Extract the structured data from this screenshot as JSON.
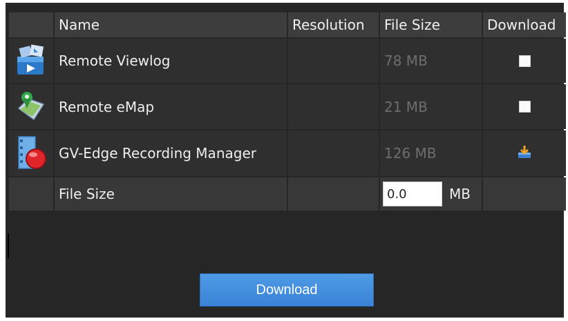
{
  "table": {
    "headers": {
      "name": "Name",
      "resolution": "Resolution",
      "file_size": "File Size",
      "download": "Download"
    },
    "rows": [
      {
        "name": "Remote Viewlog",
        "resolution": "",
        "file_size": "78 MB",
        "download_state": "unchecked",
        "icon": "remote-viewlog-icon"
      },
      {
        "name": "Remote eMap",
        "resolution": "",
        "file_size": "21 MB",
        "download_state": "unchecked",
        "icon": "remote-emap-icon"
      },
      {
        "name": "GV-Edge Recording Manager",
        "resolution": "",
        "file_size": "126 MB",
        "download_state": "download-icon",
        "icon": "recording-manager-icon"
      }
    ],
    "footer": {
      "label": "File Size",
      "value": "0.0",
      "unit": "MB"
    }
  },
  "actions": {
    "download_label": "Download"
  },
  "colors": {
    "background": "#262626",
    "header": "#3d3d3d",
    "row": "#2f2f2f",
    "muted_text": "#6e6e6e",
    "button": "#4a90e2"
  }
}
